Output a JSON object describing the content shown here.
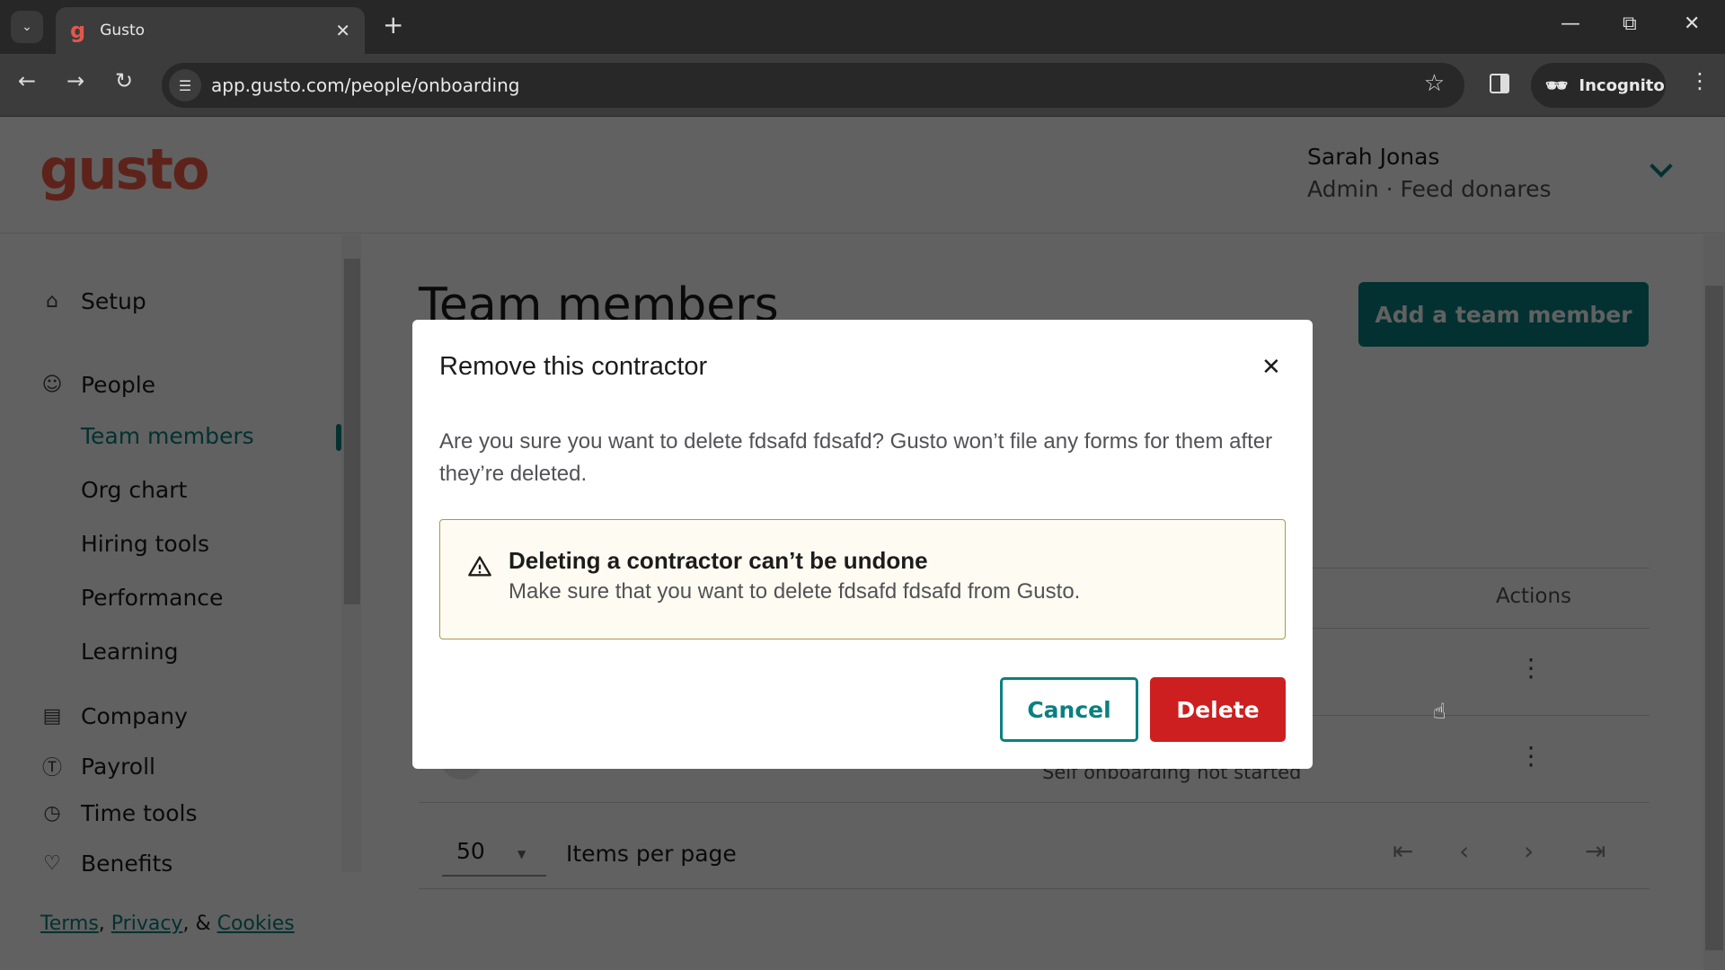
{
  "browser": {
    "tab_title": "Gusto",
    "tab_favicon": "g",
    "url": "app.gusto.com/people/onboarding",
    "incognito_label": "Incognito"
  },
  "header": {
    "logo": "gusto",
    "user_name": "Sarah Jonas",
    "user_role": "Admin · Feed donares"
  },
  "sidebar": {
    "items": [
      {
        "label": "Setup",
        "icon": "home-icon"
      },
      {
        "label": "People",
        "icon": "people-icon"
      },
      {
        "label": "Company",
        "icon": "building-icon"
      },
      {
        "label": "Payroll",
        "icon": "dollar-icon"
      },
      {
        "label": "Time tools",
        "icon": "clock-icon"
      },
      {
        "label": "Benefits",
        "icon": "heart-icon"
      }
    ],
    "people_subitems": [
      {
        "label": "Team members",
        "active": true
      },
      {
        "label": "Org chart"
      },
      {
        "label": "Hiring tools"
      },
      {
        "label": "Performance"
      },
      {
        "label": "Learning"
      }
    ],
    "footer": {
      "terms": "Terms",
      "privacy": "Privacy",
      "and": ", & ",
      "cookies": "Cookies",
      "comma": ", "
    }
  },
  "main": {
    "title": "Team members",
    "add_button": "Add a team member",
    "table": {
      "actions_header": "Actions",
      "rows": [
        {
          "status": ""
        },
        {
          "status": "Self onboarding not started"
        }
      ]
    },
    "pagination": {
      "per_page_value": "50",
      "per_page_label": "Items per page"
    }
  },
  "modal": {
    "title": "Remove this contractor",
    "body": "Are you sure you want to delete fdsafd fdsafd? Gusto won’t file any forms for them after they’re deleted.",
    "alert_title": "Deleting a contractor can’t be undone",
    "alert_body": "Make sure that you want to delete fdsafd fdsafd from Gusto.",
    "cancel_label": "Cancel",
    "delete_label": "Delete"
  },
  "colors": {
    "brand": "#f45d48",
    "accent": "#0a8080",
    "danger": "#cd1f1f",
    "alert_bg": "#fefbf2"
  }
}
